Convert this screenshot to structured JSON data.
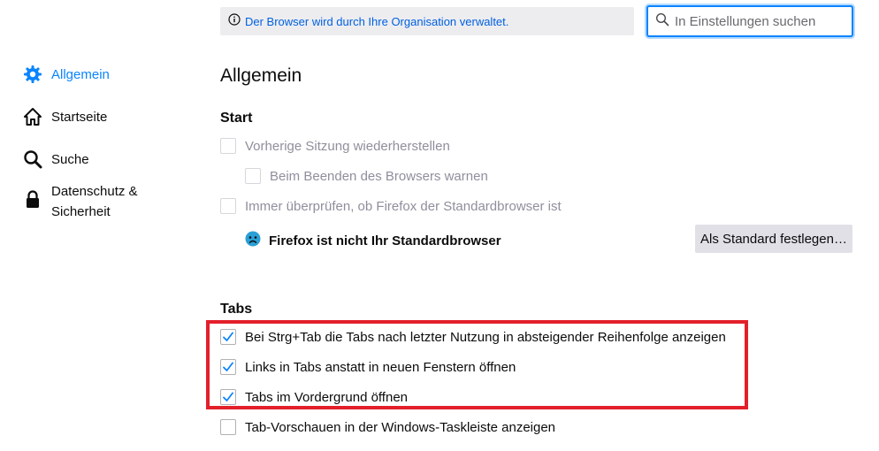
{
  "banner": {
    "text": "Der Browser wird durch Ihre Organisation verwaltet.",
    "icon": "info-icon"
  },
  "search": {
    "placeholder": "In Einstellungen suchen",
    "value": ""
  },
  "sidebar": {
    "items": [
      {
        "label": "Allgemein",
        "icon": "gear-icon",
        "selected": true
      },
      {
        "label": "Startseite",
        "icon": "home-icon",
        "selected": false
      },
      {
        "label": "Suche",
        "icon": "search-icon",
        "selected": false
      },
      {
        "label": "Datenschutz &",
        "label2": "Sicherheit",
        "icon": "lock-icon",
        "selected": false
      }
    ]
  },
  "main": {
    "title": "Allgemein",
    "start": {
      "heading": "Start",
      "restore_session": "Vorherige Sitzung wiederherstellen",
      "warn_on_quit": "Beim Beenden des Browsers warnen",
      "always_check": "Immer überprüfen, ob Firefox der Standardbrowser ist",
      "not_default": "Firefox ist nicht Ihr Standardbrowser",
      "set_default_button": "Als Standard festlegen…"
    },
    "tabs": {
      "heading": "Tabs",
      "items": [
        {
          "label": "Bei Strg+Tab die Tabs nach letzter Nutzung in absteigender Reihenfolge anzeigen",
          "checked": true
        },
        {
          "label": "Links in Tabs anstatt in neuen Fenstern öffnen",
          "checked": true
        },
        {
          "label": "Tabs im Vordergrund öffnen",
          "checked": true
        },
        {
          "label": "Tab-Vorschauen in der Windows-Taskleiste anzeigen",
          "checked": false
        }
      ]
    }
  },
  "colors": {
    "accent": "#0a84ff",
    "link": "#0060df",
    "highlight": "#e3202a"
  }
}
